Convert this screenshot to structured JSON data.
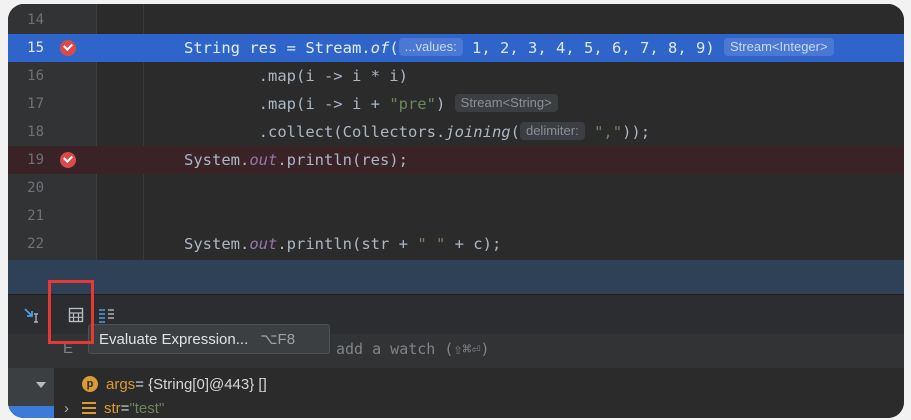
{
  "editor": {
    "lines": [
      {
        "num": "14"
      },
      {
        "num": "15"
      },
      {
        "num": "16"
      },
      {
        "num": "17"
      },
      {
        "num": "18"
      },
      {
        "num": "19"
      },
      {
        "num": "20"
      },
      {
        "num": "21"
      },
      {
        "num": "22"
      }
    ],
    "l15": {
      "a": "String res = Stream.",
      "b": "of",
      "c": "(",
      "hint": "...values:",
      "nums": "1, 2, 3, 4, 5, 6, 7, 8, 9",
      "d": ")",
      "type": "Stream<Integer>"
    },
    "l16": {
      "text": "        .map(i -> i * i)"
    },
    "l17": {
      "a": "        .map(i -> i + ",
      "str": "\"pre\"",
      "b": ")",
      "type": "Stream<String>"
    },
    "l18": {
      "a": "        .collect(Collectors.",
      "b": "joining",
      "c": "(",
      "hint": "delimiter:",
      "str": "\",\"",
      "d": "));"
    },
    "l19": {
      "a": "System.",
      "fld": "out",
      "b": ".println(res);"
    },
    "l22": {
      "a": "System.",
      "fld": "out",
      "b": ".println(str + ",
      "str": "\" \"",
      "c": " + c);"
    }
  },
  "tooltip": {
    "label": "Evaluate Expression...",
    "shortcut": "⌥F8"
  },
  "watch": {
    "hint": "add a watch (⇧⌘⏎)",
    "left": "E"
  },
  "variables": [
    {
      "name": "args",
      "value": " = {String[0]@443} []"
    },
    {
      "name": "str",
      "eq": " = ",
      "value": "\"test\""
    }
  ],
  "colors": {
    "accent": "#2f65ca",
    "breakpoint": "#d94a4a",
    "highlight": "#e53935"
  }
}
